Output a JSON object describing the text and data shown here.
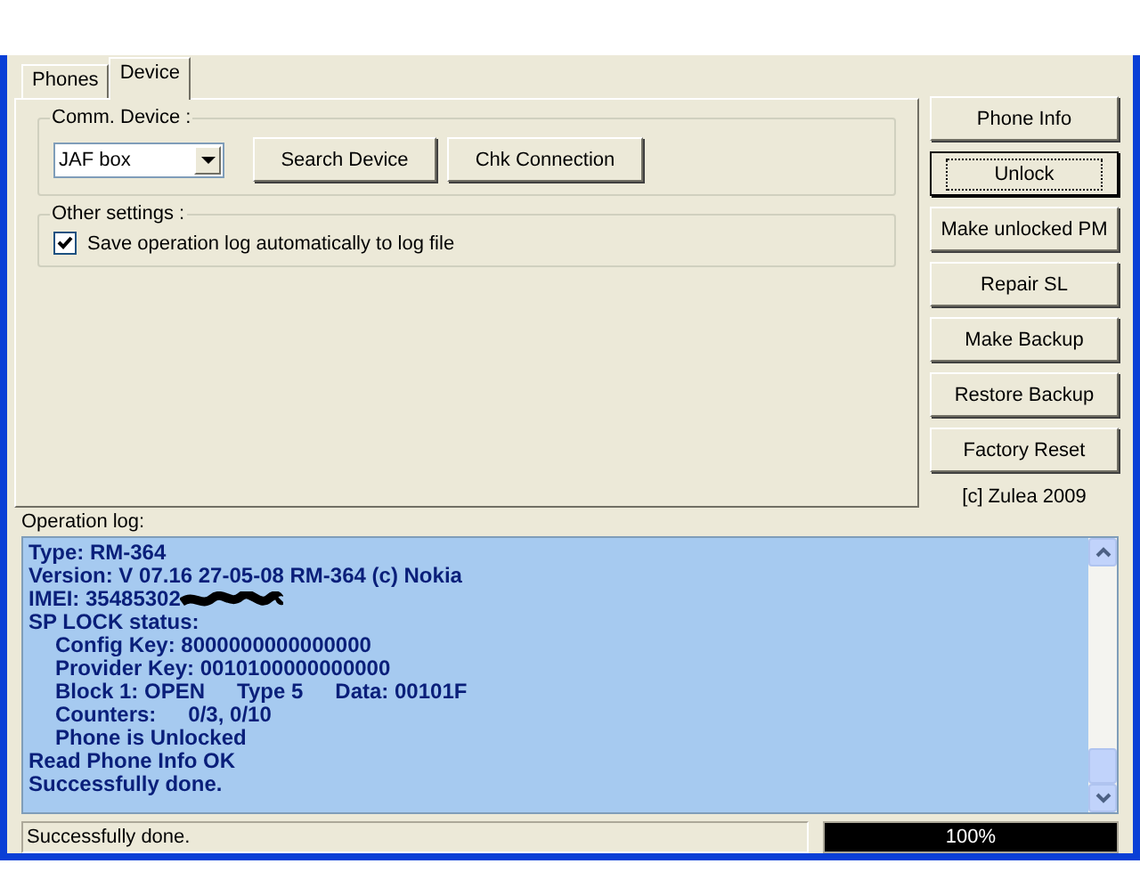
{
  "tabs": [
    {
      "label": "Phones",
      "selected": false
    },
    {
      "label": "Device",
      "selected": true
    }
  ],
  "comm_device": {
    "legend": "Comm. Device :",
    "dropdown": {
      "value": "JAF box"
    },
    "buttons": [
      "Search Device",
      "Chk Connection"
    ]
  },
  "other_settings": {
    "legend": "Other settings :",
    "checkbox": {
      "label": "Save operation log automatically to log file",
      "checked": true
    }
  },
  "actions": [
    {
      "label": "Phone Info",
      "focused": false
    },
    {
      "label": "Unlock",
      "focused": true
    },
    {
      "label": "Make unlocked PM",
      "focused": false
    },
    {
      "label": "Repair SL",
      "focused": false
    },
    {
      "label": "Make Backup",
      "focused": false
    },
    {
      "label": "Restore Backup",
      "focused": false
    },
    {
      "label": "Factory Reset",
      "focused": false
    }
  ],
  "copyright": "[c] Zulea 2009",
  "log": {
    "label": "Operation log:",
    "lines": [
      {
        "parts": [
          "Type: RM-364"
        ]
      },
      {
        "parts": [
          "Version: V 07.16 27-05-08 RM-364 (c) Nokia"
        ]
      },
      {
        "parts": [
          "IMEI: 35485302"
        ],
        "redacted": true
      },
      {
        "parts": [
          "SP LOCK status:"
        ],
        "children": [
          {
            "parts": [
              "Config Key: 8000000000000000"
            ]
          },
          {
            "parts": [
              "Provider Key: 0010100000000000"
            ]
          },
          {
            "parts": [
              "Block 1: OPEN",
              "Type 5",
              "Data: 00101F"
            ]
          },
          {
            "parts": [
              "Counters:",
              "0/3, 0/10"
            ]
          },
          {
            "parts": [
              "Phone is Unlocked"
            ]
          }
        ]
      },
      {
        "parts": [
          "Read Phone Info OK"
        ]
      },
      {
        "parts": [
          "Successfully done."
        ]
      }
    ]
  },
  "status_bar": {
    "text": "Successfully done.",
    "progress": {
      "level": 1,
      "reading": "100%"
    }
  }
}
